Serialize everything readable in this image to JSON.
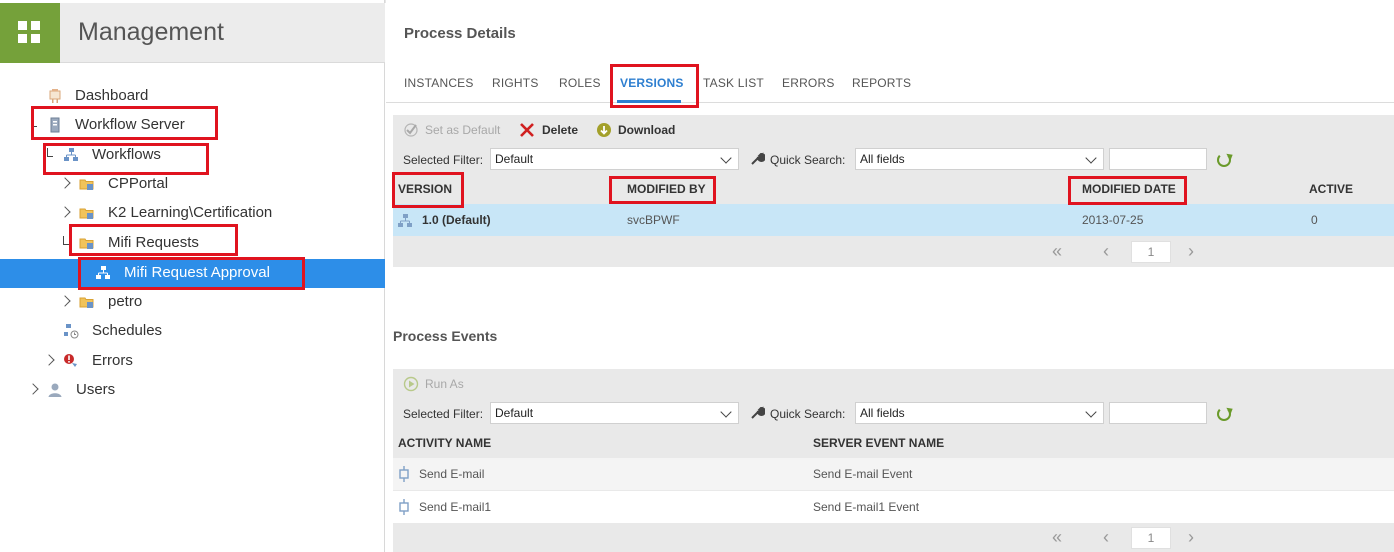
{
  "app": {
    "title": "Management"
  },
  "tree": {
    "dashboard": "Dashboard",
    "workflow_server": "Workflow Server",
    "workflows": "Workflows",
    "cpportal": "CPPortal",
    "k2_learning": "K2 Learning\\Certification",
    "mifi_requests": "Mifi Requests",
    "mifi_request_approval": "Mifi Request Approval",
    "petro": "petro",
    "schedules": "Schedules",
    "errors": "Errors",
    "users": "Users"
  },
  "process_details": {
    "title": "Process Details",
    "tabs": [
      "INSTANCES",
      "RIGHTS",
      "ROLES",
      "VERSIONS",
      "TASK LIST",
      "ERRORS",
      "REPORTS"
    ],
    "active_tab": "VERSIONS"
  },
  "versions_grid": {
    "toolbar": {
      "set_default": "Set as Default",
      "delete": "Delete",
      "download": "Download"
    },
    "filter": {
      "label": "Selected Filter:",
      "value": "Default",
      "quick_search_label": "Quick Search:",
      "quick_search_value": "All fields"
    },
    "columns": [
      "VERSION",
      "MODIFIED BY",
      "MODIFIED DATE",
      "ACTIVE"
    ],
    "rows": [
      {
        "version": "1.0 (Default)",
        "modified_by": "svcBPWF",
        "modified_date": "2013-07-25",
        "active": "0"
      }
    ],
    "page": "1"
  },
  "process_events": {
    "title": "Process Events",
    "toolbar": {
      "run_as": "Run As"
    },
    "filter": {
      "label": "Selected Filter:",
      "value": "Default",
      "quick_search_label": "Quick Search:",
      "quick_search_value": "All fields"
    },
    "columns": [
      "ACTIVITY NAME",
      "SERVER EVENT NAME"
    ],
    "rows": [
      {
        "activity": "Send E-mail",
        "event": "Send E-mail Event"
      },
      {
        "activity": "Send E-mail1",
        "event": "Send E-mail1 Event"
      }
    ],
    "page": "1"
  },
  "colors": {
    "accent": "#2e7fd0",
    "selected": "#2d8ee8",
    "highlight": "#e0131f",
    "tile": "#75a13a"
  }
}
